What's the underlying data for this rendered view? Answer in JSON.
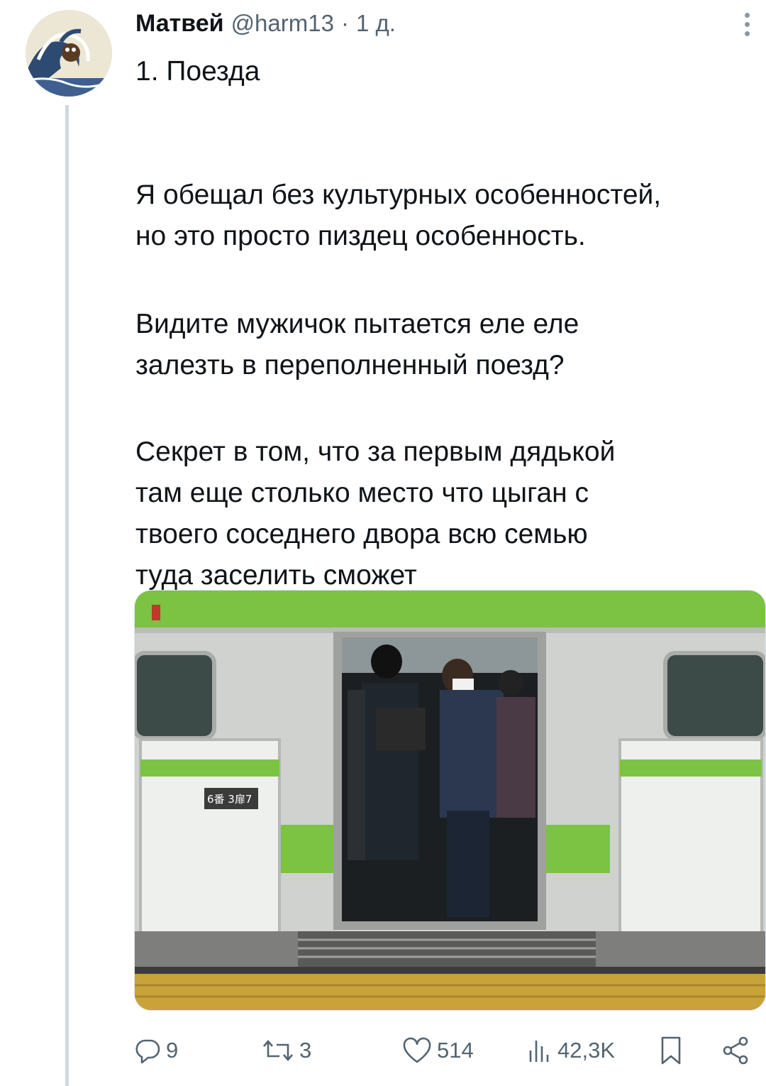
{
  "tweet": {
    "author_name": "Матвей",
    "handle": "@harm13",
    "separator": "·",
    "age": "1 д.",
    "avatar_icon": "great-wave-avatar",
    "paragraphs": [
      [
        "1. Поезда"
      ],
      [
        "Я обещал без культурных особенностей,",
        "но это просто пиздец особенность."
      ],
      [
        "Видите мужичок пытается еле еле",
        "залезть в переполненный поезд?"
      ],
      [
        "Секрет в том, что за первым дядькой",
        "там еще столько место что цыган с",
        "твоего соседнего двора всю семью",
        "туда заселить сможет"
      ]
    ],
    "media": {
      "icon": "crowded-train-photo",
      "platform_sign": "6番 3扉7"
    },
    "actions": {
      "replies": "9",
      "retweets": "3",
      "likes": "514",
      "views": "42,3K"
    }
  },
  "colors": {
    "text_primary": "#0f1419",
    "text_secondary": "#536471",
    "thread_line": "#cfd9de",
    "train_green": "#7cc243"
  }
}
